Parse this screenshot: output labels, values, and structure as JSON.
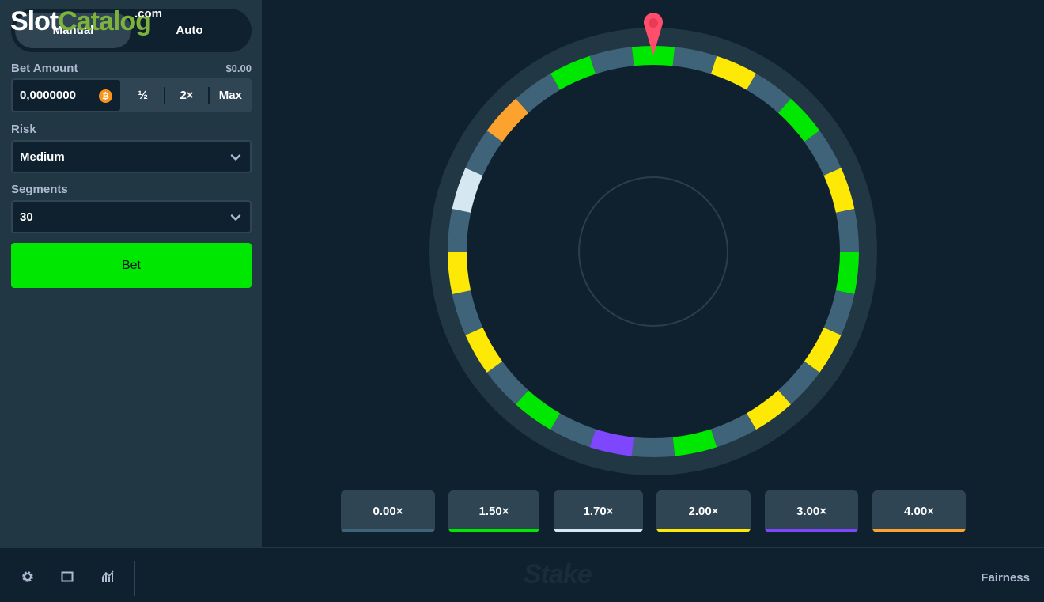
{
  "sidebar": {
    "mode_manual": "Manual",
    "mode_auto": "Auto",
    "bet_amount_label": "Bet Amount",
    "bet_amount_usd": "$0.00",
    "bet_amount_value": "0,0000000",
    "currency_icon": "bitcoin-icon",
    "half_label": "½",
    "double_label": "2×",
    "max_label": "Max",
    "risk_label": "Risk",
    "risk_value": "Medium",
    "segments_label": "Segments",
    "segments_value": "30",
    "bet_button": "Bet"
  },
  "watermark": {
    "slot": "Slot",
    "catalog": "Catalog",
    "com": ".com"
  },
  "wheel": {
    "segment_count": 30,
    "segments": [
      "green",
      "grey",
      "yellow",
      "grey",
      "green",
      "grey",
      "yellow",
      "grey",
      "green",
      "grey",
      "yellow",
      "grey",
      "yellow",
      "grey",
      "green",
      "grey",
      "purple",
      "grey",
      "green",
      "grey",
      "yellow",
      "grey",
      "yellow",
      "grey",
      "white",
      "grey",
      "orange",
      "grey",
      "green",
      "grey"
    ],
    "colors": {
      "grey": "#3f6479",
      "green": "#00e701",
      "yellow": "#fde905",
      "purple": "#7f47fd",
      "white": "#d5e8f2",
      "orange": "#fca32f"
    },
    "pointer_color": "#ff4e6b"
  },
  "multipliers": [
    {
      "label": "0.00×",
      "color": "#3f6479"
    },
    {
      "label": "1.50×",
      "color": "#00e701"
    },
    {
      "label": "1.70×",
      "color": "#d5e8f2"
    },
    {
      "label": "2.00×",
      "color": "#fde905"
    },
    {
      "label": "3.00×",
      "color": "#7f47fd"
    },
    {
      "label": "4.00×",
      "color": "#fca32f"
    }
  ],
  "footer": {
    "settings_icon": "gear-icon",
    "theatre_icon": "square-icon",
    "stats_icon": "chart-icon",
    "logo": "Stake",
    "fairness": "Fairness"
  }
}
